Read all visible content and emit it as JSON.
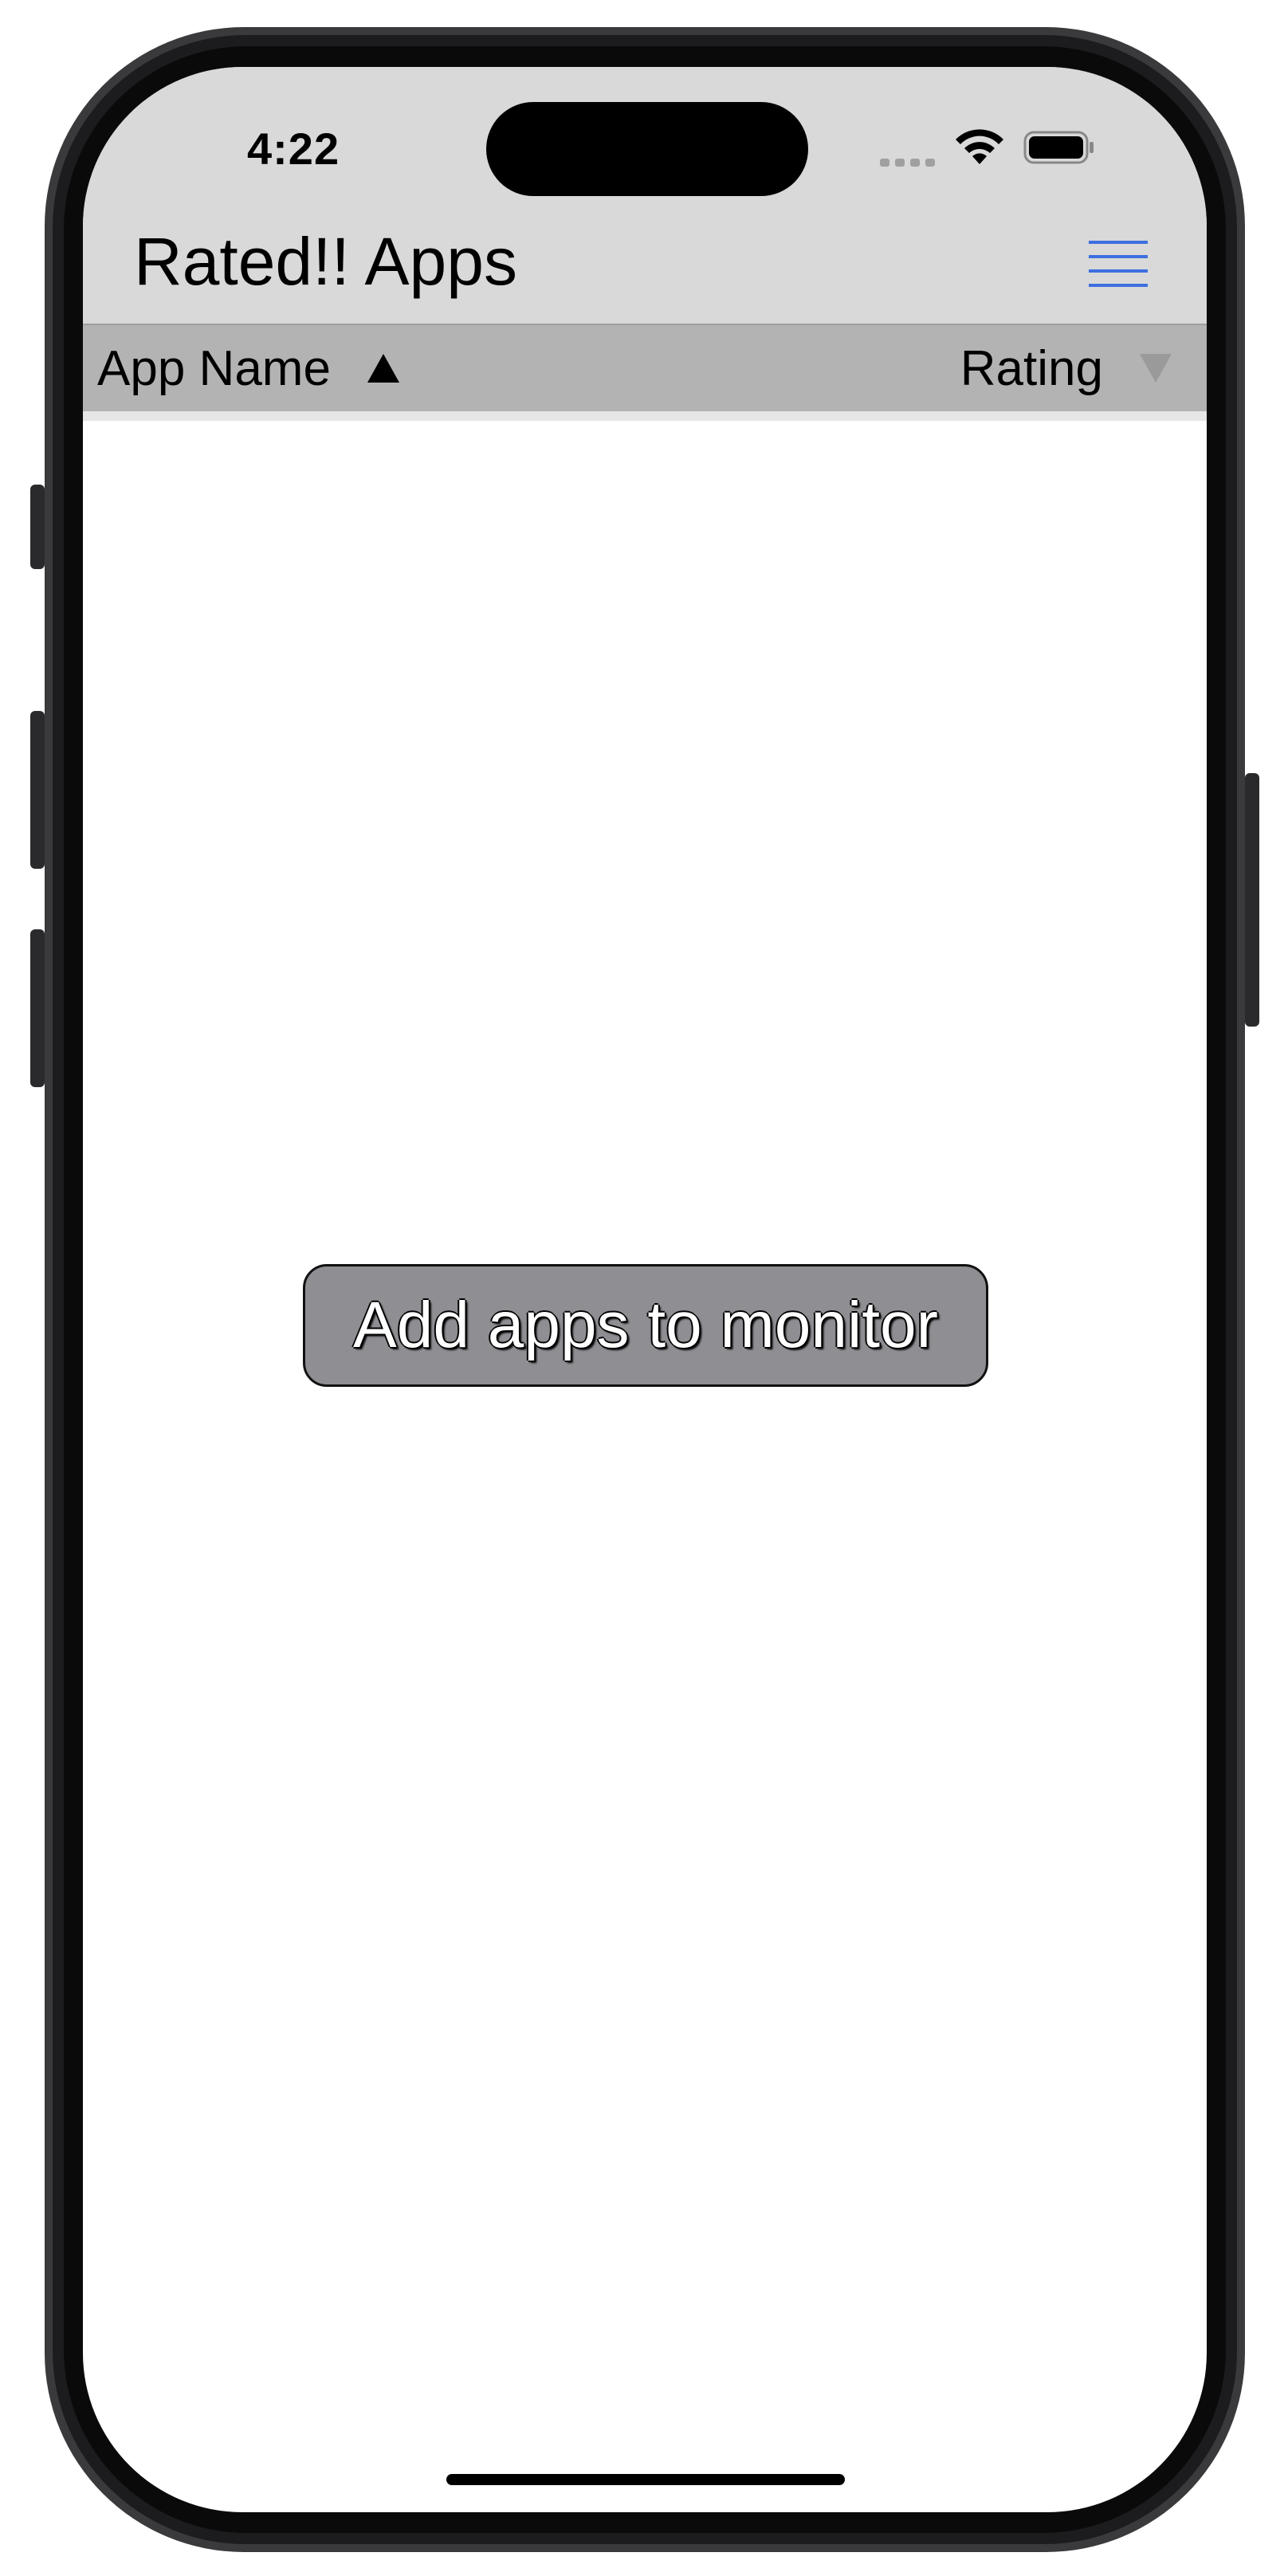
{
  "status_bar": {
    "time": "4:22",
    "wifi_icon": "wifi-icon",
    "battery_icon": "battery-icon",
    "cellular_icon": "cellular-dots-icon"
  },
  "header": {
    "title": "Rated!! Apps",
    "menu_icon": "hamburger-menu-icon",
    "accent_color": "#3d6fe0"
  },
  "sort_bar": {
    "app_name_label": "App Name",
    "app_name_sort": "ascending",
    "rating_label": "Rating",
    "rating_sort": "inactive"
  },
  "main": {
    "add_button_label": "Add apps to monitor"
  }
}
